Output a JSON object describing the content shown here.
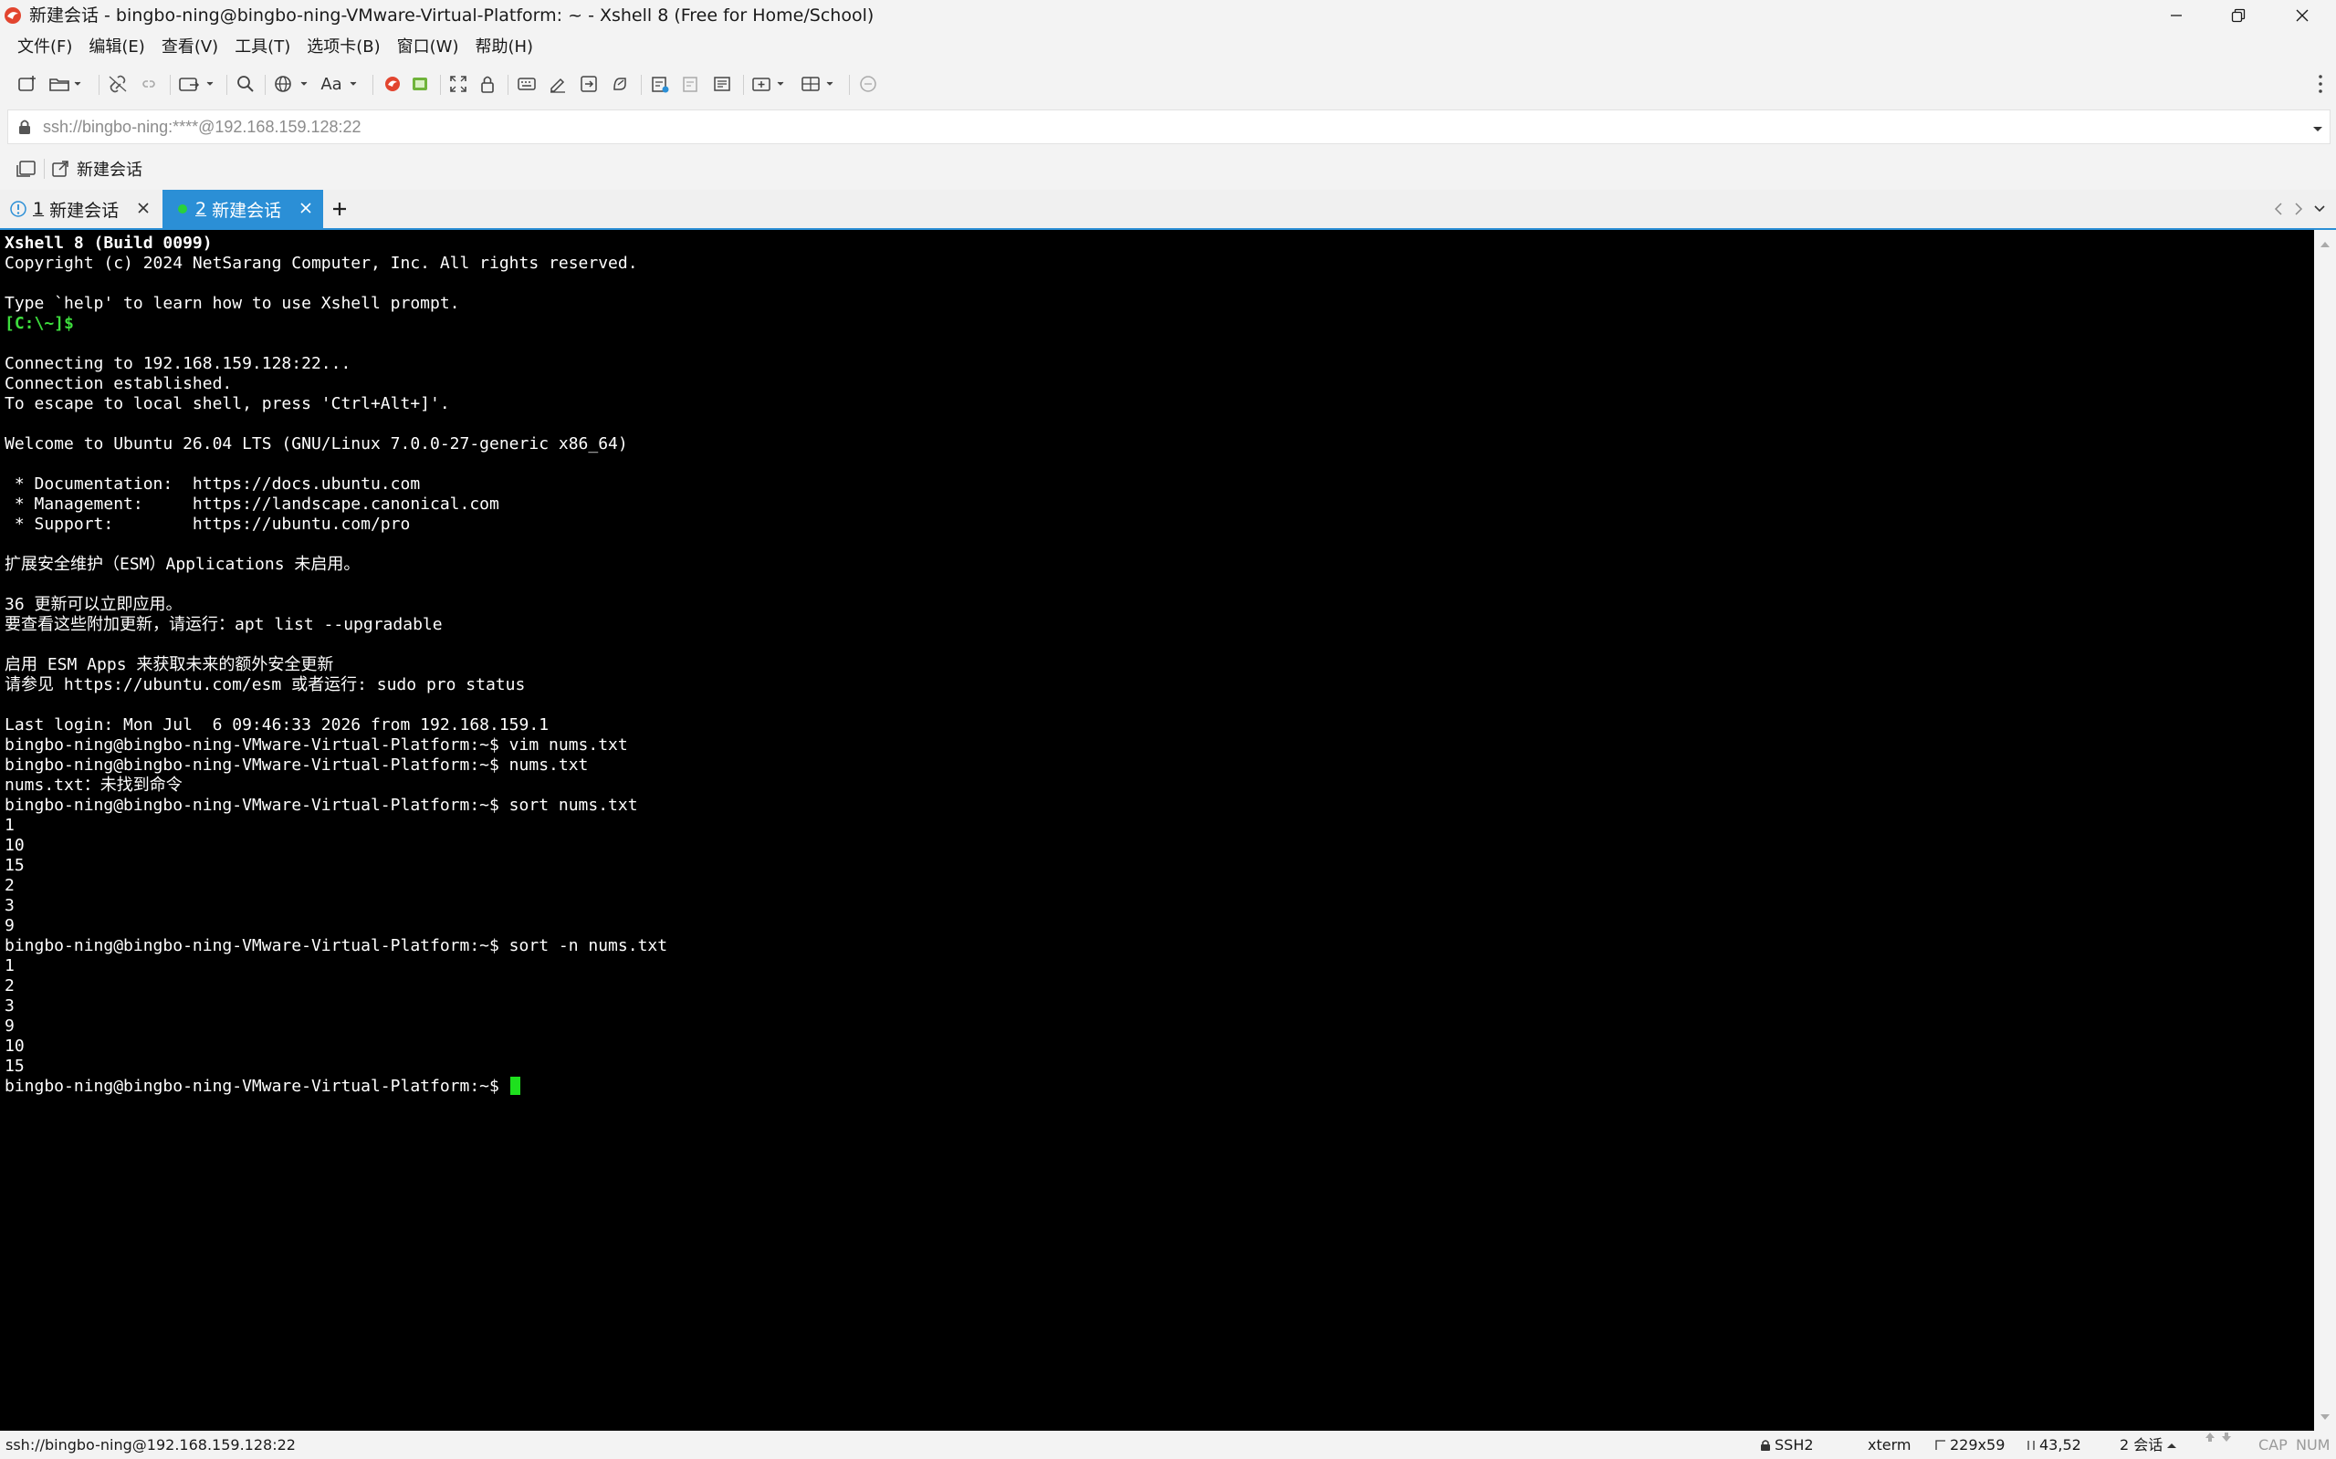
{
  "window": {
    "title": "新建会话 - bingbo-ning@bingbo-ning-VMware-Virtual-Platform: ~ - Xshell 8 (Free for Home/School)"
  },
  "menu": [
    {
      "label": "文件(F)"
    },
    {
      "label": "编辑(E)"
    },
    {
      "label": "查看(V)"
    },
    {
      "label": "工具(T)"
    },
    {
      "label": "选项卡(B)"
    },
    {
      "label": "窗口(W)"
    },
    {
      "label": "帮助(H)"
    }
  ],
  "toolbar": {
    "font_label": "Aa"
  },
  "address": {
    "value": "ssh://bingbo-ning:****@192.168.159.128:22"
  },
  "links": {
    "item_label": "新建会话"
  },
  "tabs": [
    {
      "number": "1",
      "label": "新建会话",
      "status": "warning",
      "active": false
    },
    {
      "number": "2",
      "label": "新建会话",
      "status": "connected",
      "active": true
    }
  ],
  "terminal": {
    "lines": [
      {
        "text": "Xshell 8 (Build 0099)",
        "style": "bold"
      },
      {
        "text": "Copyright (c) 2024 NetSarang Computer, Inc. All rights reserved.",
        "style": "normal"
      },
      {
        "text": "",
        "style": "normal"
      },
      {
        "text": "Type `help' to learn how to use Xshell prompt.",
        "style": "normal"
      },
      {
        "text": "[C:\\~]$",
        "style": "green"
      },
      {
        "text": "",
        "style": "normal"
      },
      {
        "text": "Connecting to 192.168.159.128:22...",
        "style": "normal"
      },
      {
        "text": "Connection established.",
        "style": "normal"
      },
      {
        "text": "To escape to local shell, press 'Ctrl+Alt+]'.",
        "style": "normal"
      },
      {
        "text": "",
        "style": "normal"
      },
      {
        "text": "Welcome to Ubuntu 26.04 LTS (GNU/Linux 7.0.0-27-generic x86_64)",
        "style": "normal"
      },
      {
        "text": "",
        "style": "normal"
      },
      {
        "text": " * Documentation:  https://docs.ubuntu.com",
        "style": "normal"
      },
      {
        "text": " * Management:     https://landscape.canonical.com",
        "style": "normal"
      },
      {
        "text": " * Support:        https://ubuntu.com/pro",
        "style": "normal"
      },
      {
        "text": "",
        "style": "normal"
      },
      {
        "text": "扩展安全维护（ESM）Applications 未启用。",
        "style": "normal"
      },
      {
        "text": "",
        "style": "normal"
      },
      {
        "text": "36 更新可以立即应用。",
        "style": "normal"
      },
      {
        "text": "要查看这些附加更新，请运行：apt list --upgradable",
        "style": "normal"
      },
      {
        "text": "",
        "style": "normal"
      },
      {
        "text": "启用 ESM Apps 来获取未来的额外安全更新",
        "style": "normal"
      },
      {
        "text": "请参见 https://ubuntu.com/esm 或者运行: sudo pro status",
        "style": "normal"
      },
      {
        "text": "",
        "style": "normal"
      },
      {
        "text": "Last login: Mon Jul  6 09:46:33 2026 from 192.168.159.1",
        "style": "normal"
      },
      {
        "text": "bingbo-ning@bingbo-ning-VMware-Virtual-Platform:~$ vim nums.txt",
        "style": "normal"
      },
      {
        "text": "bingbo-ning@bingbo-ning-VMware-Virtual-Platform:~$ nums.txt",
        "style": "normal"
      },
      {
        "text": "nums.txt：未找到命令",
        "style": "normal"
      },
      {
        "text": "bingbo-ning@bingbo-ning-VMware-Virtual-Platform:~$ sort nums.txt",
        "style": "normal"
      },
      {
        "text": "1",
        "style": "normal"
      },
      {
        "text": "10",
        "style": "normal"
      },
      {
        "text": "15",
        "style": "normal"
      },
      {
        "text": "2",
        "style": "normal"
      },
      {
        "text": "3",
        "style": "normal"
      },
      {
        "text": "9",
        "style": "normal"
      },
      {
        "text": "bingbo-ning@bingbo-ning-VMware-Virtual-Platform:~$ sort -n nums.txt",
        "style": "normal"
      },
      {
        "text": "1",
        "style": "normal"
      },
      {
        "text": "2",
        "style": "normal"
      },
      {
        "text": "3",
        "style": "normal"
      },
      {
        "text": "9",
        "style": "normal"
      },
      {
        "text": "10",
        "style": "normal"
      },
      {
        "text": "15",
        "style": "normal"
      }
    ],
    "prompt": "bingbo-ning@bingbo-ning-VMware-Virtual-Platform:~$ "
  },
  "status": {
    "left": "ssh://bingbo-ning@192.168.159.128:22",
    "protocol": "SSH2",
    "term_type": "xterm",
    "size": "229x59",
    "cursor_pos": "43,52",
    "sessions": "2 会话",
    "cap": "CAP",
    "num": "NUM"
  },
  "colors": {
    "accent": "#2b8fd6",
    "terminal_bg": "#000000",
    "prompt_green": "#3ddc3d",
    "cursor": "#1ee01e"
  }
}
